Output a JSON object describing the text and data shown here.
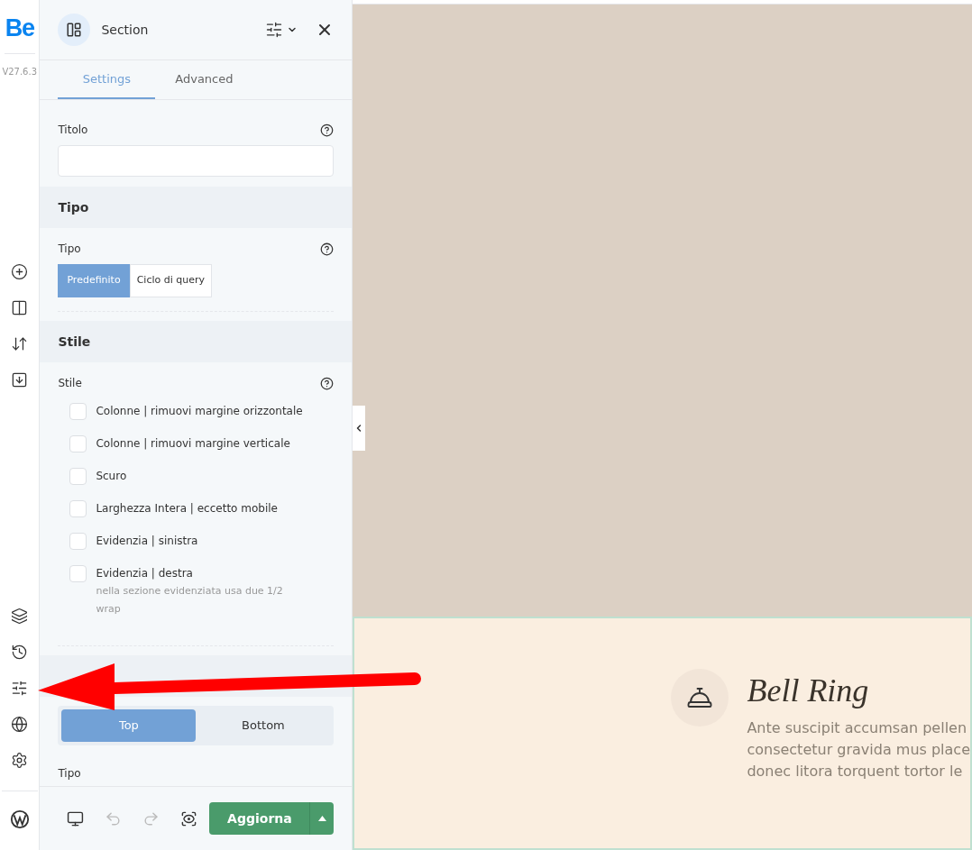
{
  "rail": {
    "logo": "Be",
    "version": "V27.6.3"
  },
  "panel": {
    "title": "Section",
    "tabs": [
      {
        "label": "Settings",
        "selected": true
      },
      {
        "label": "Advanced",
        "selected": false
      }
    ],
    "title_field": {
      "label": "Titolo"
    },
    "type_section": {
      "heading": "Tipo",
      "label": "Tipo",
      "options": [
        {
          "label": "Predefinito",
          "selected": true
        },
        {
          "label": "Ciclo di query",
          "selected": false
        }
      ]
    },
    "style_section": {
      "heading": "Stile",
      "label": "Stile",
      "options": [
        {
          "label": "Colonne | rimuovi margine orizzontale",
          "checked": false
        },
        {
          "label": "Colonne | rimuovi margine verticale",
          "checked": false
        },
        {
          "label": "Scuro",
          "checked": false
        },
        {
          "label": "Larghezza Intera | eccetto mobile",
          "checked": false
        },
        {
          "label": "Evidenzia | sinistra",
          "checked": false
        },
        {
          "label": "Evidenzia | destra",
          "checked": false,
          "note": "nella sezione evidenziata usa due 1/2 wrap"
        }
      ]
    },
    "position_section": {
      "options": [
        {
          "label": "Top",
          "selected": true
        },
        {
          "label": "Bottom",
          "selected": false
        }
      ],
      "next_label": "Tipo"
    },
    "footer": {
      "tools": [
        {
          "kind": "monitor",
          "disabled": false
        },
        {
          "kind": "undo",
          "disabled": true
        },
        {
          "kind": "redo",
          "disabled": true
        },
        {
          "kind": "preview",
          "disabled": false
        }
      ],
      "button": "Aggiorna"
    }
  },
  "canvas": {
    "feature": {
      "title": "Bell Ring",
      "lines": [
        "Ante suscipit accumsan pellen",
        "consectetur gravida mus place",
        "donec litora torquent tortor le"
      ]
    }
  }
}
